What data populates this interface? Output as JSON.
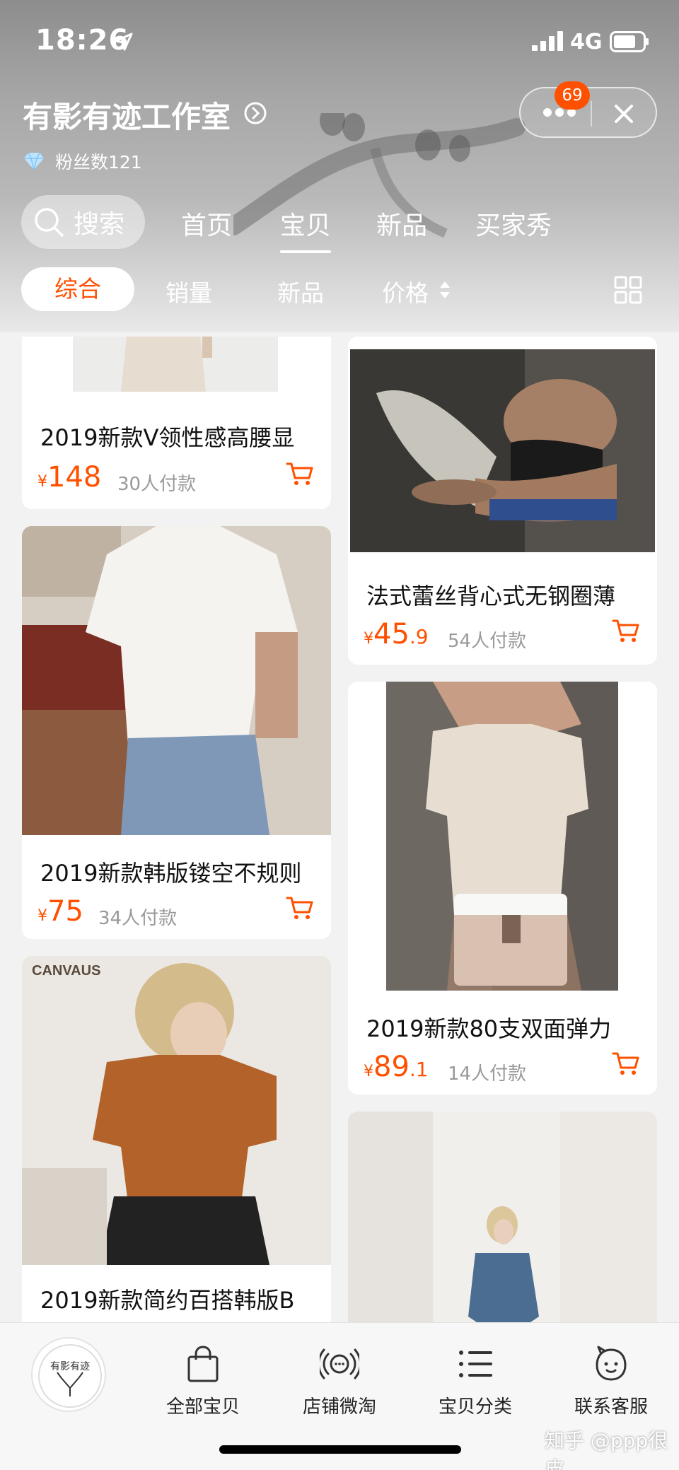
{
  "status_bar": {
    "time": "18:26",
    "network": "4G"
  },
  "shop": {
    "name": "有影有迹工作室",
    "fans_label": "粉丝数121"
  },
  "capsule": {
    "badge_count": "69"
  },
  "nav": {
    "search_label": "搜索",
    "tabs": [
      {
        "label": "首页",
        "active": false
      },
      {
        "label": "宝贝",
        "active": true
      },
      {
        "label": "新品",
        "active": false
      },
      {
        "label": "买家秀",
        "active": false
      }
    ]
  },
  "sort": {
    "items": [
      {
        "label": "综合",
        "active": true
      },
      {
        "label": "销量",
        "active": false
      },
      {
        "label": "新品",
        "active": false
      },
      {
        "label": "价格",
        "active": false
      }
    ]
  },
  "products": [
    {
      "title": "2019新款V领性感高腰显",
      "currency": "¥",
      "price_int": "148",
      "price_dec": "",
      "paid": "30人付款"
    },
    {
      "title": "法式蕾丝背心式无钢圈薄",
      "currency": "¥",
      "price_int": "45",
      "price_dec": ".9",
      "paid": "54人付款"
    },
    {
      "title": "2019新款韩版镂空不规则",
      "currency": "¥",
      "price_int": "75",
      "price_dec": "",
      "paid": "34人付款"
    },
    {
      "title": "2019新款80支双面弹力",
      "currency": "¥",
      "price_int": "89",
      "price_dec": ".1",
      "paid": "14人付款"
    },
    {
      "title": "2019新款简约百搭韩版B",
      "currency": "",
      "price_int": "",
      "price_dec": "",
      "paid": ""
    },
    {
      "title": "",
      "currency": "",
      "price_int": "",
      "price_dec": "",
      "paid": ""
    }
  ],
  "product_image_text": {
    "canvaus": "CANVAUS"
  },
  "tabbar": {
    "logo_text": "有影有迹",
    "items": [
      {
        "label": "全部宝贝",
        "icon": "bag-icon"
      },
      {
        "label": "店铺微淘",
        "icon": "broadcast-icon"
      },
      {
        "label": "宝贝分类",
        "icon": "list-icon"
      },
      {
        "label": "联系客服",
        "icon": "customer-service-icon"
      }
    ]
  },
  "watermark": "知乎 @ppp很皮",
  "colors": {
    "accent": "#ff5000",
    "background": "#f2f2f2"
  }
}
